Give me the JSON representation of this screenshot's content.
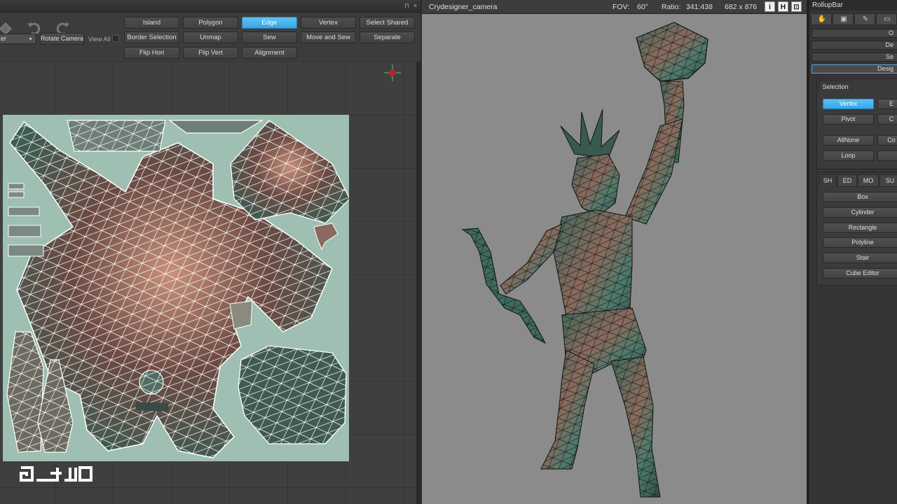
{
  "uv_editor": {
    "titlebar_icons": [
      "pin-icon",
      "close-icon"
    ],
    "tool_icons": [
      "paint-bucket-icon",
      "undo-icon",
      "redo-icon"
    ],
    "buttons_row1": [
      "Island",
      "Polygon",
      "Edge",
      "Vertex",
      "Select Shared"
    ],
    "buttons_row2": [
      "Border Selection",
      "Unmap",
      "Sew",
      "Move and Sew",
      "Separate"
    ],
    "buttons_row3": [
      "Flip Hori",
      "Flip Vert",
      "Alignment"
    ],
    "active_mode": "Edge",
    "view_dropdown": "er",
    "rotate_camera": "Rotate Camera",
    "view_all": "View All",
    "view_all_checked": false
  },
  "camera": {
    "title": "Crydesigner_camera",
    "fov_label": "FOV:",
    "fov_value": "60°",
    "ratio_label": "Ratio:",
    "ratio_value": "341:438",
    "resolution": "682 x 876",
    "buttons": [
      "i",
      "H",
      "⊡"
    ]
  },
  "rollup": {
    "title": "RollupBar",
    "tabs": [
      "hand-icon",
      "objects-icon",
      "brush-icon",
      "display-icon"
    ],
    "rows": [
      "O",
      "De",
      "Se",
      "Desig"
    ],
    "selected_row": "Desig",
    "selection_label": "Selection",
    "selection_buttons": [
      {
        "label": "Vertex",
        "active": true
      },
      {
        "label": "E",
        "active": false
      },
      {
        "label": "Pivot",
        "active": false
      },
      {
        "label": "C",
        "active": false
      },
      {
        "label": "AllNone",
        "active": false
      },
      {
        "label": "Co",
        "active": false
      },
      {
        "label": "Loop",
        "active": false
      },
      {
        "label": "",
        "active": false
      }
    ],
    "shape_tabs": [
      "SH",
      "ED",
      "MO",
      "SU"
    ],
    "active_shape_tab": "SH",
    "shape_buttons": [
      "Box",
      "Cylinder",
      "Rectangle",
      "Polyline",
      "Stair",
      "Cube Editor"
    ]
  },
  "colors": {
    "accent": "#45b4ec",
    "texture_bg": "#9ebfb2",
    "statue_base": "#3d5c52",
    "viewport_bg": "#8b8b8b"
  }
}
